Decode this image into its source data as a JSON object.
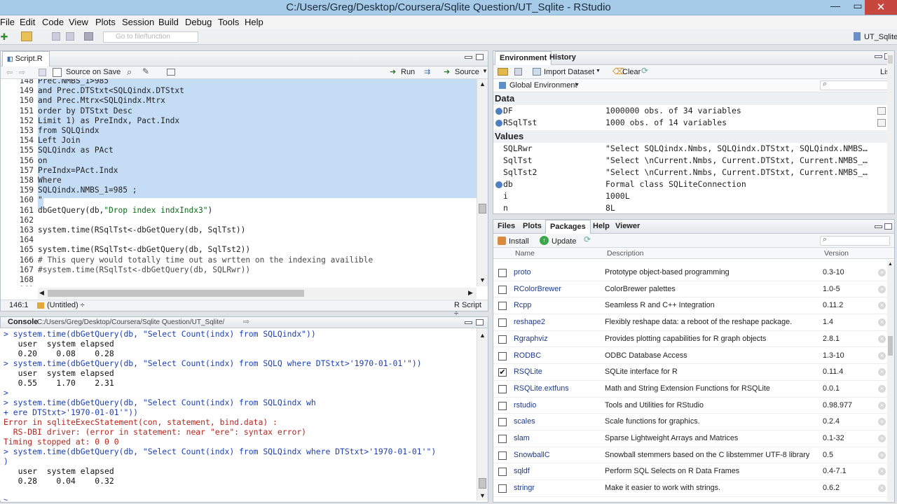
{
  "window": {
    "title": "C:/Users/Greg/Desktop/Coursera/Sqlite Question/UT_Sqlite - RStudio",
    "min": "—",
    "max": "▭",
    "close": "✕"
  },
  "menu": [
    "File",
    "Edit",
    "Code",
    "View",
    "Plots",
    "Session",
    "Build",
    "Debug",
    "Tools",
    "Help"
  ],
  "toolbar": {
    "goto_placeholder": "Go to file/function",
    "project": "UT_Sqlite"
  },
  "editor": {
    "tab": "Script.R",
    "source_on_save": "Source on Save",
    "run": "Run",
    "source": "Source",
    "line_numbers": [
      "148",
      "149",
      "150",
      "151",
      "152",
      "153",
      "154",
      "155",
      "156",
      "157",
      "158",
      "159",
      "160",
      "161",
      "162",
      "163",
      "164",
      "165",
      "166",
      "167",
      "168",
      "169"
    ],
    "lines": [
      "Prec.NMBS_1>985",
      "and Prec.DTStxt<SQLQindx.DTStxt",
      "and Prec.Mtrx<SQLQindx.Mtrx",
      "order by DTStxt Desc",
      "Limit 1) as PreIndx, Pact.Indx",
      "from SQLQindx",
      "Left Join",
      "SQLQindx as PAct",
      "on",
      "PreIndx=PAct.Indx",
      "Where",
      "SQLQindx.NMBS_1=985 ;",
      "\"",
      "dbGetQuery(db,\"Drop index indxIndx3\")",
      "",
      "system.time(RSqlTst<-dbGetQuery(db, SqlTst))",
      "",
      "system.time(RSqlTst<-dbGetQuery(db, SqlTst2))",
      "# This query would totally time out as wrtten on the indexing availible",
      "#system.time(RSqlTst<-dbGetQuery(db, SQLRwr))",
      "",
      "..."
    ],
    "status_pos": "146:1",
    "status_scope": "(Untitled) ÷",
    "status_type": "R Script ÷"
  },
  "console": {
    "title": "Console",
    "path": "C:/Users/Greg/Desktop/Coursera/Sqlite Question/UT_Sqlite/",
    "lines": [
      {
        "t": "> system.time(dbGetQuery(db, \"Select Count(indx) from SQLQindx\"))",
        "c": "c-blue"
      },
      {
        "t": "   user  system elapsed",
        "c": "c-black"
      },
      {
        "t": "   0.20    0.08    0.28",
        "c": "c-black"
      },
      {
        "t": "> system.time(dbGetQuery(db, \"Select Count(indx) from SQLQ where DTStxt>'1970-01-01'\"))",
        "c": "c-blue"
      },
      {
        "t": "   user  system elapsed",
        "c": "c-black"
      },
      {
        "t": "   0.55    1.70    2.31",
        "c": "c-black"
      },
      {
        "t": ">",
        "c": "c-blue"
      },
      {
        "t": "> system.time(dbGetQuery(db, \"Select Count(indx) from SQLQindx wh",
        "c": "c-blue"
      },
      {
        "t": "+ ere DTStxt>'1970-01-01'\"))",
        "c": "c-blue"
      },
      {
        "t": "Error in sqliteExecStatement(con, statement, bind.data) :",
        "c": "c-red"
      },
      {
        "t": "  RS-DBI driver: (error in statement: near \"ere\": syntax error)",
        "c": "c-red"
      },
      {
        "t": "Timing stopped at: 0 0 0",
        "c": "c-red"
      },
      {
        "t": "> system.time(dbGetQuery(db, \"Select Count(indx) from SQLQindx where DTStxt>'1970-01-01'\")",
        "c": "c-blue"
      },
      {
        "t": ")",
        "c": "c-blue"
      },
      {
        "t": "   user  system elapsed",
        "c": "c-black"
      },
      {
        "t": "   0.28    0.04    0.32",
        "c": "c-black"
      },
      {
        "t": "",
        "c": "c-black"
      },
      {
        "t": ">",
        "c": "c-blue"
      }
    ]
  },
  "env": {
    "tabs": [
      "Environment",
      "History"
    ],
    "import": "Import Dataset",
    "clear": "Clear",
    "list": "List",
    "scope": "Global Environment",
    "data_header": "Data",
    "values_header": "Values",
    "data": [
      {
        "name": "DF",
        "val": "1000000 obs. of 34 variables"
      },
      {
        "name": "RSqlTst",
        "val": "1000 obs. of 14 variables"
      }
    ],
    "values": [
      {
        "name": "SQLRwr",
        "val": "\"Select SQLQindx.Nmbs, SQLQindx.DTStxt, SQLQindx.NMBS…"
      },
      {
        "name": "SqlTst",
        "val": "\"Select \\nCurrent.Nmbs, Current.DTStxt, Current.NMBS_…"
      },
      {
        "name": "SqlTst2",
        "val": "\"Select \\nCurrent.Nmbs, Current.DTStxt, Current.NMBS_…"
      },
      {
        "name": "db",
        "val": "Formal class SQLiteConnection"
      },
      {
        "name": "i",
        "val": "1000L"
      },
      {
        "name": "n",
        "val": "8L"
      }
    ]
  },
  "files": {
    "tabs": [
      "Files",
      "Plots",
      "Packages",
      "Help",
      "Viewer"
    ],
    "install": "Install",
    "update": "Update",
    "col_name": "Name",
    "col_desc": "Description",
    "col_ver": "Version",
    "packages": [
      {
        "name": "proto",
        "desc": "Prototype object-based programming",
        "ver": "0.3-10",
        "checked": ""
      },
      {
        "name": "RColorBrewer",
        "desc": "ColorBrewer palettes",
        "ver": "1.0-5",
        "checked": ""
      },
      {
        "name": "Rcpp",
        "desc": "Seamless R and C++ Integration",
        "ver": "0.11.2",
        "checked": ""
      },
      {
        "name": "reshape2",
        "desc": "Flexibly reshape data: a reboot of the reshape package.",
        "ver": "1.4",
        "checked": ""
      },
      {
        "name": "Rgraphviz",
        "desc": "Provides plotting capabilities for R graph objects",
        "ver": "2.8.1",
        "checked": ""
      },
      {
        "name": "RODBC",
        "desc": "ODBC Database Access",
        "ver": "1.3-10",
        "checked": ""
      },
      {
        "name": "RSQLite",
        "desc": "SQLite interface for R",
        "ver": "0.11.4",
        "checked": "✔"
      },
      {
        "name": "RSQLite.extfuns",
        "desc": "Math and String Extension Functions for RSQLite",
        "ver": "0.0.1",
        "checked": ""
      },
      {
        "name": "rstudio",
        "desc": "Tools and Utilities for RStudio",
        "ver": "0.98.977",
        "checked": ""
      },
      {
        "name": "scales",
        "desc": "Scale functions for graphics.",
        "ver": "0.2.4",
        "checked": ""
      },
      {
        "name": "slam",
        "desc": "Sparse Lightweight Arrays and Matrices",
        "ver": "0.1-32",
        "checked": ""
      },
      {
        "name": "SnowballC",
        "desc": "Snowball stemmers based on the C libstemmer UTF-8 library",
        "ver": "0.5",
        "checked": ""
      },
      {
        "name": "sqldf",
        "desc": "Perform SQL Selects on R Data Frames",
        "ver": "0.4-7.1",
        "checked": ""
      },
      {
        "name": "stringr",
        "desc": "Make it easier to work with strings.",
        "ver": "0.6.2",
        "checked": ""
      }
    ]
  }
}
